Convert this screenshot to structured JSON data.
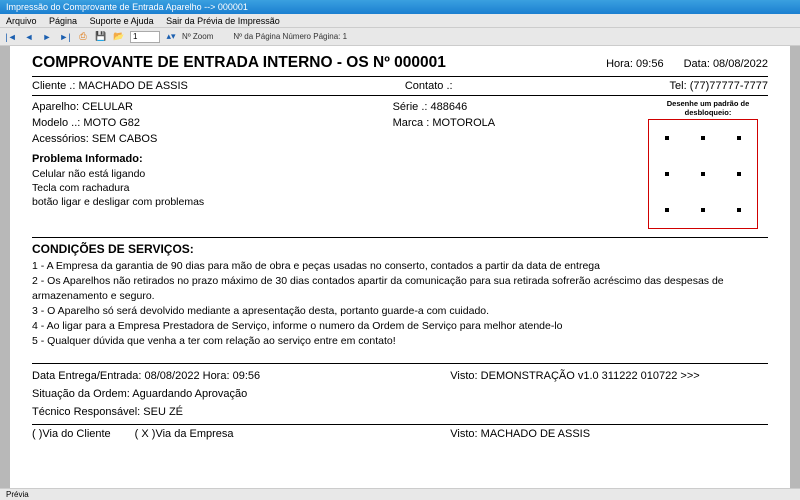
{
  "window": {
    "title": "Impressão do Comprovante de Entrada Aparelho --> 000001"
  },
  "menu": {
    "arquivo": "Arquivo",
    "pagina": "Página",
    "suporte": "Suporte e Ajuda",
    "sair": "Sair da Prévia de Impressão"
  },
  "toolbar": {
    "zoom_value": "1",
    "zoom_label": "Nº Zoom",
    "page_label": "Nº da Página  Número Página: 1"
  },
  "statusbar": {
    "text": "Prévia"
  },
  "doc": {
    "title": "COMPROVANTE DE ENTRADA INTERNO - OS Nº 000001",
    "hora_label": "Hora: ",
    "hora": "09:56",
    "data_label": "Data: ",
    "data": "08/08/2022",
    "cliente_label": "Cliente   .:",
    "cliente": " MACHADO DE ASSIS",
    "contato_label": "Contato .:",
    "tel_label": "Tel: ",
    "tel": "(77)77777-7777",
    "aparelho_label": "Aparelho: ",
    "aparelho": "CELULAR",
    "serie_label": "Série  .: ",
    "serie": "488646",
    "modelo_label": "Modelo ..: ",
    "modelo": "MOTO G82",
    "marca_label": "Marca : ",
    "marca": "MOTOROLA",
    "acessorios_label": "Acessórios: ",
    "acessorios": "SEM CABOS",
    "pattern_label": "Desenhe um padrão de desbloqueio:",
    "problema_title": "Problema Informado:",
    "problema_1": "Celular não está ligando",
    "problema_2": "Tecla com rachadura",
    "problema_3": "botão ligar e desligar com problemas",
    "cond_title": "CONDIÇÕES DE SERVIÇOS:",
    "cond_1": "1 - A Empresa da garantia de 90 dias para mão de obra e peças usadas no conserto, contados  a partir da data de entrega",
    "cond_2": "2 - Os Aparelhos não retirados no prazo máximo de 30 dias contados apartir da comunicação para sua retirada sofrerão acréscimo das despesas de armazenamento e seguro.",
    "cond_3": "3 - O Aparelho só será devolvido mediante a apresentação desta, portanto guarde-a com cuidado.",
    "cond_4": "4 - Ao ligar para a Empresa Prestadora de Serviço, informe o numero da Ordem de Serviço para melhor atende-lo",
    "cond_5": "5 - Qualquer dúvida que venha a ter com relação ao serviço entre em contato!",
    "entrega_line": "Data Entrega/Entrada: 08/08/2022   Hora:  09:56",
    "visto1": "Visto: DEMONSTRAÇÃO v1.0 311222 010722 >>>",
    "situacao": "Situação da Ordem: Aguardando Aprovação",
    "tecnico": "Técnico Responsável: SEU ZÉ",
    "via_cliente": "(    )Via do Cliente",
    "via_empresa": "( X )Via da Empresa",
    "visto2": "Visto: MACHADO DE ASSIS"
  }
}
